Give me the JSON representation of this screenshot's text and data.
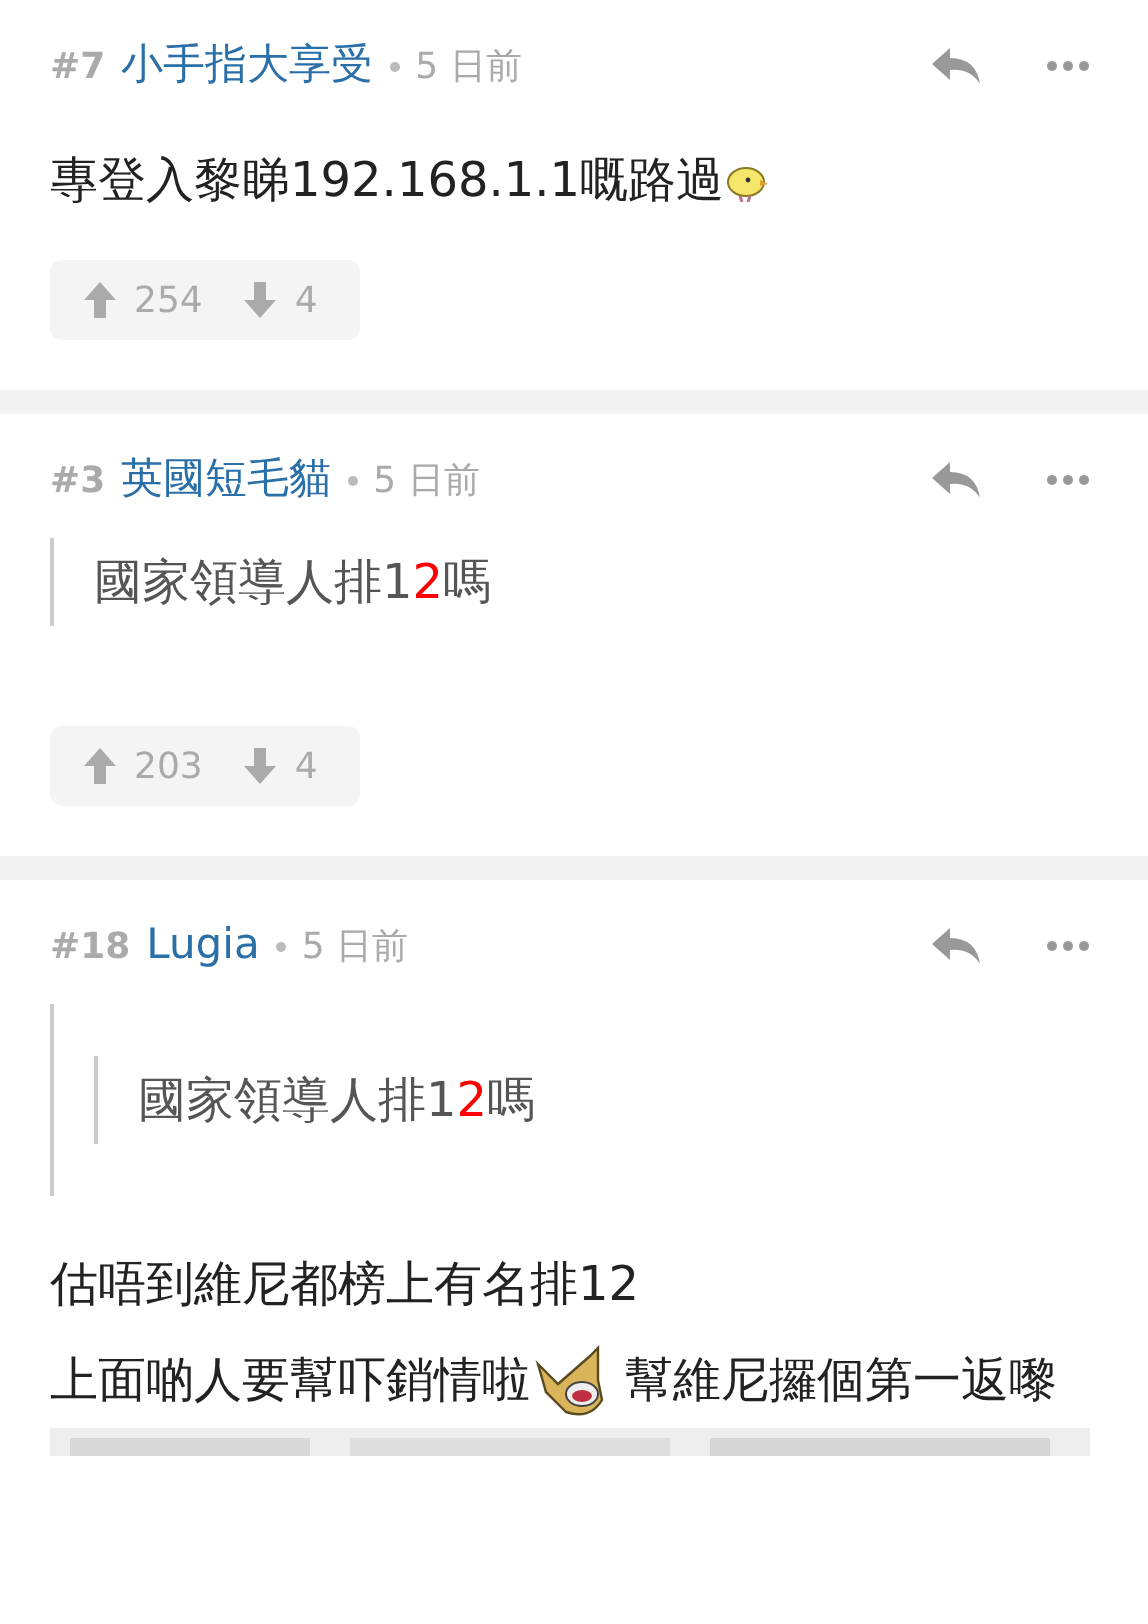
{
  "comments": [
    {
      "number": "#7",
      "author": "小手指大享受",
      "time": "5 日前",
      "body": [
        [
          {
            "kind": "text",
            "text": "專登入黎睇192.168.1.1嘅路過"
          },
          {
            "kind": "emoji"
          }
        ]
      ],
      "votes": {
        "up": "254",
        "down": "4"
      }
    },
    {
      "number": "#3",
      "author": "英國短毛貓",
      "time": "5 日前",
      "quote": {
        "segments": [
          {
            "text": "國家領導人排1"
          },
          {
            "text": "2",
            "color": "#ff0000"
          },
          {
            "text": "嗎"
          }
        ]
      },
      "votes": {
        "up": "203",
        "down": "4"
      }
    },
    {
      "number": "#18",
      "author": "Lugia",
      "time": "5 日前",
      "quote": {
        "quote": {
          "segments": [
            {
              "text": "國家領導人排1"
            },
            {
              "text": "2",
              "color": "#ff0000"
            },
            {
              "text": "嗎"
            }
          ]
        }
      },
      "body": [
        [
          {
            "kind": "text",
            "text": "估唔到維尼都榜上有名排12"
          }
        ],
        [
          {
            "kind": "text",
            "text": "上面啲人要幫吓銷情啦"
          },
          {
            "kind": "sticker"
          },
          {
            "kind": "text",
            "text": " 幫維尼攞個第一返嚟"
          }
        ]
      ],
      "attachment": {
        "kind": "picture"
      }
    }
  ]
}
